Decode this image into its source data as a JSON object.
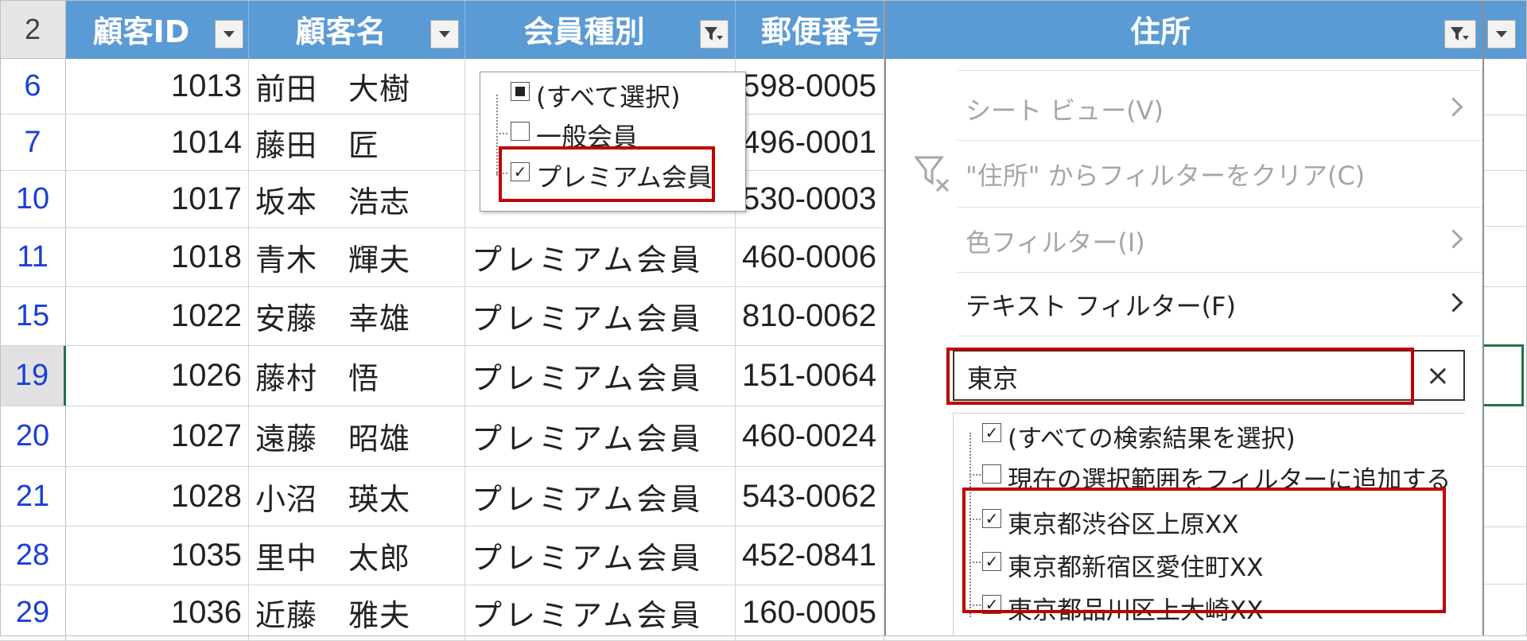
{
  "header": {
    "row_number": "2",
    "columns": [
      {
        "label": "顧客ID",
        "filter": "dropdown"
      },
      {
        "label": "顧客名",
        "filter": "dropdown"
      },
      {
        "label": "会員種別",
        "filter": "filtered"
      },
      {
        "label": "郵便番号",
        "filter": "none"
      },
      {
        "label": "住所",
        "filter": "filtered"
      }
    ]
  },
  "rows": [
    {
      "row": "6",
      "id": "1013",
      "name": "前田　大樹",
      "type": "",
      "zip": "598-0005"
    },
    {
      "row": "7",
      "id": "1014",
      "name": "藤田　匠",
      "type": "",
      "zip": "496-0001"
    },
    {
      "row": "10",
      "id": "1017",
      "name": "坂本　浩志",
      "type": "",
      "zip": "530-0003"
    },
    {
      "row": "11",
      "id": "1018",
      "name": "青木　輝夫",
      "type": "プレミアム会員",
      "zip": "460-0006"
    },
    {
      "row": "15",
      "id": "1022",
      "name": "安藤　幸雄",
      "type": "プレミアム会員",
      "zip": "810-0062"
    },
    {
      "row": "19",
      "id": "1026",
      "name": "藤村　悟",
      "type": "プレミアム会員",
      "zip": "151-0064"
    },
    {
      "row": "20",
      "id": "1027",
      "name": "遠藤　昭雄",
      "type": "プレミアム会員",
      "zip": "460-0024"
    },
    {
      "row": "21",
      "id": "1028",
      "name": "小沼　瑛太",
      "type": "プレミアム会員",
      "zip": "543-0062"
    },
    {
      "row": "28",
      "id": "1035",
      "name": "里中　太郎",
      "type": "プレミアム会員",
      "zip": "452-0841"
    },
    {
      "row": "29",
      "id": "1036",
      "name": "近藤　雅夫",
      "type": "プレミアム会員",
      "zip": "160-0005"
    }
  ],
  "member_filter_popup": {
    "options": [
      {
        "label": "(すべて選択)",
        "state": "partial"
      },
      {
        "label": "一般会員",
        "state": "unchecked"
      },
      {
        "label": "プレミアム会員",
        "state": "checked"
      }
    ]
  },
  "address_filter_menu": {
    "sheet_view": "シート ビュー(V)",
    "clear_filter": "\"住所\" からフィルターをクリア(C)",
    "color_filter": "色フィルター(I)",
    "text_filter": "テキスト フィルター(F)",
    "search_value": "東京",
    "clear_icon": "×",
    "results": [
      {
        "label": "(すべての検索結果を選択)",
        "checked": true
      },
      {
        "label": "現在の選択範囲をフィルターに追加する",
        "checked": false
      },
      {
        "label": "東京都渋谷区上原XX",
        "checked": true
      },
      {
        "label": "東京都新宿区愛住町XX",
        "checked": true
      },
      {
        "label": "東京都品川区上大崎XX",
        "checked": true
      }
    ]
  },
  "colors": {
    "header_bg": "#5b9bd5",
    "highlight": "#c00000",
    "row_number": "#1a3fd9",
    "selection": "#217346"
  }
}
